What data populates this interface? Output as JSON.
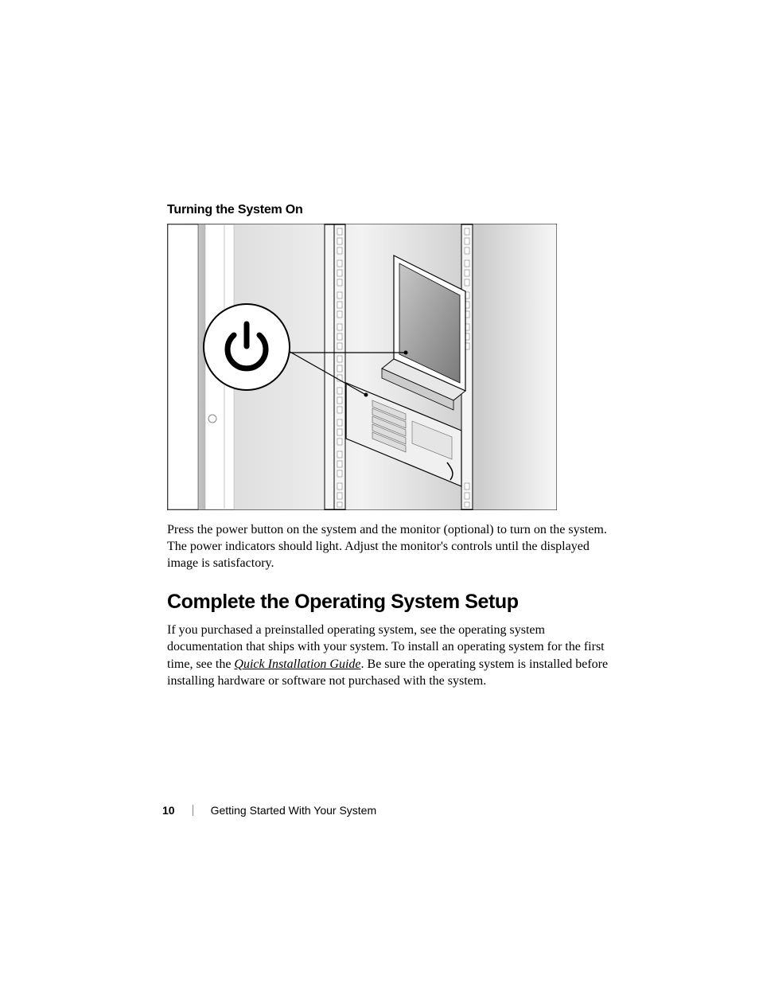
{
  "subheading": "Turning the System On",
  "figure_alt": "Illustration of a rack-mounted server with a monitor and a callout showing the power button icon",
  "caption": "Press the power button on the system and the monitor (optional) to turn on the system. The power indicators should light. Adjust the monitor's controls until the displayed image is satisfactory.",
  "section_heading": "Complete the Operating System Setup",
  "body_before_em": "If you purchased a preinstalled operating system, see the operating system documentation that ships with your system. To install an operating system for the first time, see the ",
  "body_em": "Quick Installation Guide",
  "body_after_em": ". Be sure the operating system is installed before installing hardware or software not purchased with the system.",
  "footer": {
    "page_number": "10",
    "chapter": "Getting Started With Your System"
  }
}
